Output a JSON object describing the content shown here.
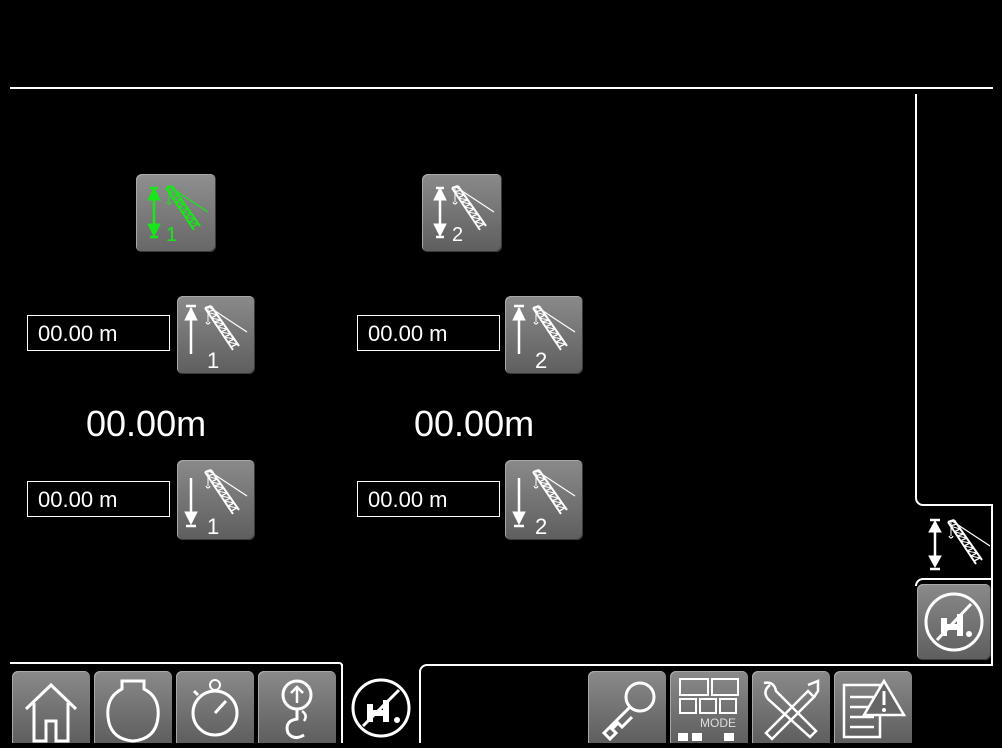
{
  "winch1": {
    "select_label": "1",
    "upper_limit_value": "00.00 m",
    "upper_button_label": "1",
    "current_height": "00.00m",
    "lower_limit_value": "00.00 m",
    "lower_button_label": "1",
    "selected": true
  },
  "winch2": {
    "select_label": "2",
    "upper_limit_value": "00.00 m",
    "upper_button_label": "2",
    "current_height": "00.00m",
    "lower_limit_value": "00.00 m",
    "lower_button_label": "2",
    "selected": false
  },
  "colors": {
    "background": "#000000",
    "line": "#ffffff",
    "active_green": "#19e619",
    "button_gray": "#707070"
  },
  "bottom_tabs": [
    {
      "icon": "home-icon"
    },
    {
      "icon": "engine-icon"
    },
    {
      "icon": "stopwatch-icon"
    },
    {
      "icon": "hook-icon"
    },
    {
      "icon": "no-hook-block-icon",
      "active": true
    },
    {
      "icon": "key-icon"
    },
    {
      "icon": "mode-icon",
      "label": "MODE"
    },
    {
      "icon": "tools-icon"
    },
    {
      "icon": "warning-log-icon"
    }
  ],
  "side_tabs": [
    {
      "icon": "hoist-limit-icon",
      "active": true
    },
    {
      "icon": "no-hook-block-icon"
    }
  ]
}
